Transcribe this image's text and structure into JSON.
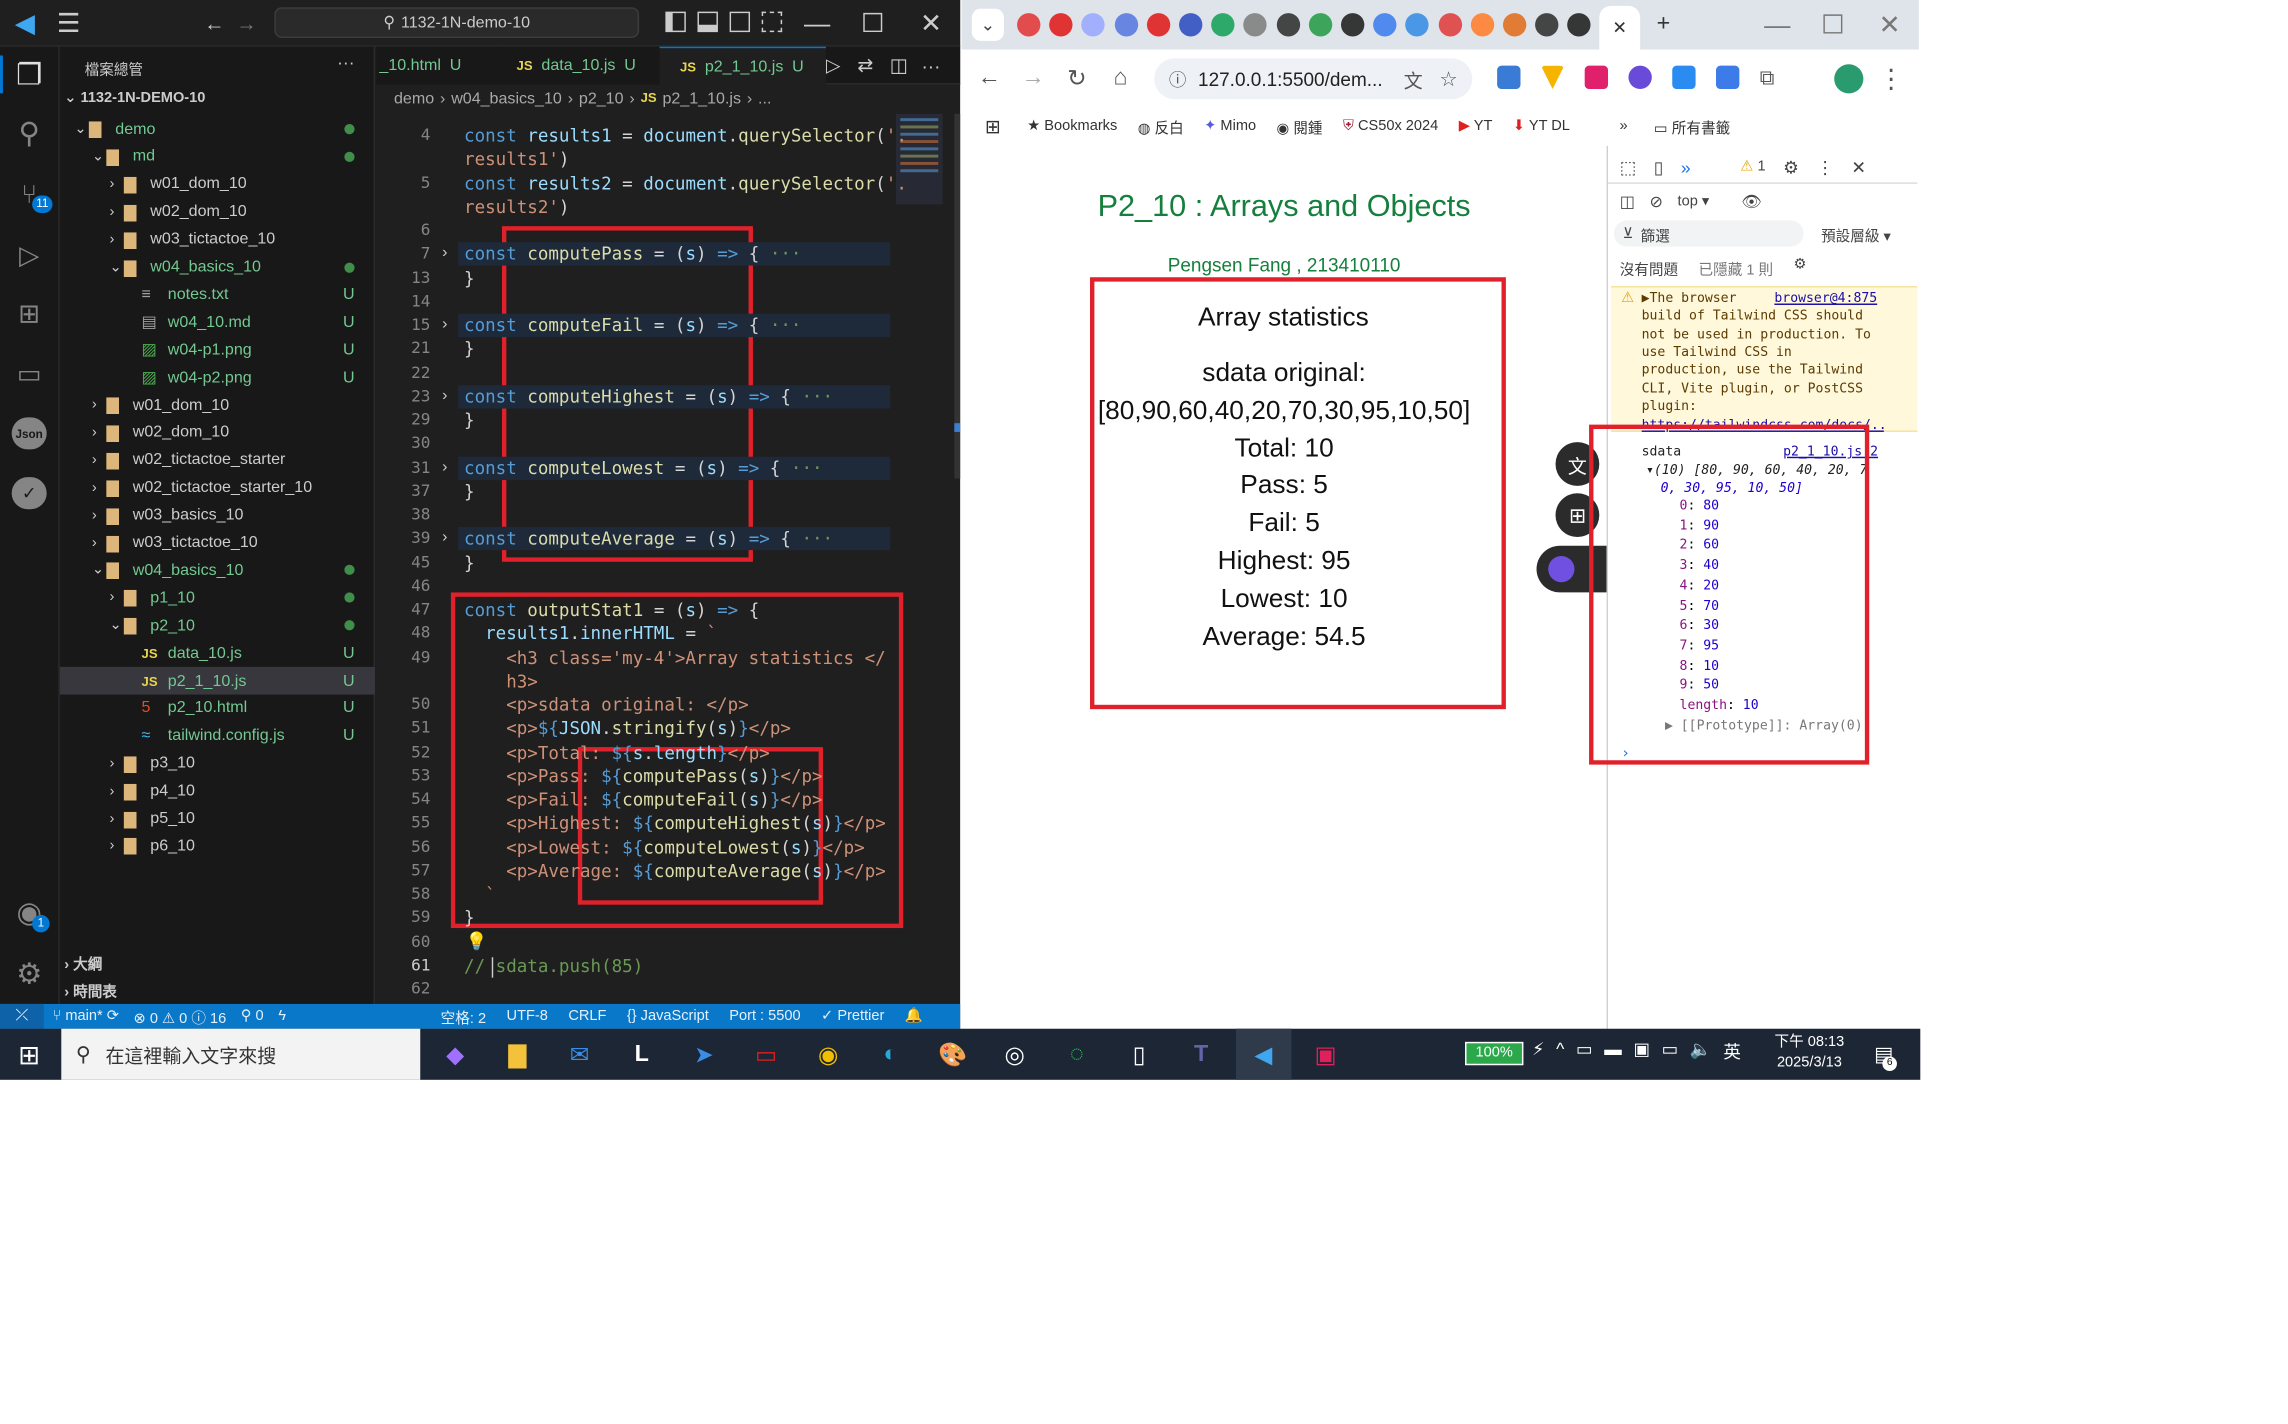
{
  "vscode": {
    "search": "1132-1N-demo-10",
    "explorer_title": "檔案總管",
    "explorer_more": "···",
    "root": "1132-1N-DEMO-10",
    "tree": [
      {
        "label": "demo",
        "indent": 0,
        "type": "folder",
        "open": true,
        "dot": true
      },
      {
        "label": "md",
        "indent": 1,
        "type": "folder",
        "open": true,
        "dot": true
      },
      {
        "label": "w01_dom_10",
        "indent": 2,
        "type": "folder",
        "open": false
      },
      {
        "label": "w02_dom_10",
        "indent": 2,
        "type": "folder",
        "open": false
      },
      {
        "label": "w03_tictactoe_10",
        "indent": 2,
        "type": "folder",
        "open": false
      },
      {
        "label": "w04_basics_10",
        "indent": 2,
        "type": "folder",
        "open": true,
        "dot": true
      },
      {
        "label": "notes.txt",
        "indent": 3,
        "type": "txt",
        "u": "U"
      },
      {
        "label": "w04_10.md",
        "indent": 3,
        "type": "md",
        "u": "U"
      },
      {
        "label": "w04-p1.png",
        "indent": 3,
        "type": "img",
        "u": "U"
      },
      {
        "label": "w04-p2.png",
        "indent": 3,
        "type": "img",
        "u": "U"
      },
      {
        "label": "w01_dom_10",
        "indent": 1,
        "type": "folder",
        "open": false
      },
      {
        "label": "w02_dom_10",
        "indent": 1,
        "type": "folder",
        "open": false
      },
      {
        "label": "w02_tictactoe_starter",
        "indent": 1,
        "type": "folder",
        "open": false
      },
      {
        "label": "w02_tictactoe_starter_10",
        "indent": 1,
        "type": "folder",
        "open": false
      },
      {
        "label": "w03_basics_10",
        "indent": 1,
        "type": "folder",
        "open": false
      },
      {
        "label": "w03_tictactoe_10",
        "indent": 1,
        "type": "folder",
        "open": false
      },
      {
        "label": "w04_basics_10",
        "indent": 1,
        "type": "folder",
        "open": true,
        "dot": true
      },
      {
        "label": "p1_10",
        "indent": 2,
        "type": "folder",
        "open": false,
        "dot": true
      },
      {
        "label": "p2_10",
        "indent": 2,
        "type": "folder",
        "open": true,
        "dot": true
      },
      {
        "label": "data_10.js",
        "indent": 3,
        "type": "js",
        "u": "U"
      },
      {
        "label": "p2_1_10.js",
        "indent": 3,
        "type": "js",
        "u": "U",
        "selected": true
      },
      {
        "label": "p2_10.html",
        "indent": 3,
        "type": "html",
        "u": "U"
      },
      {
        "label": "tailwind.config.js",
        "indent": 3,
        "type": "tw",
        "u": "U"
      },
      {
        "label": "p3_10",
        "indent": 2,
        "type": "folder",
        "open": false
      },
      {
        "label": "p4_10",
        "indent": 2,
        "type": "folder",
        "open": false
      },
      {
        "label": "p5_10",
        "indent": 2,
        "type": "folder",
        "open": false
      },
      {
        "label": "p6_10",
        "indent": 2,
        "type": "folder",
        "open": false
      }
    ],
    "outline": "大綱",
    "timeline": "時間表",
    "tabs": [
      {
        "name": "_10.html",
        "u": "U",
        "js": false
      },
      {
        "name": "data_10.js",
        "u": "U",
        "js": true
      },
      {
        "name": "p2_1_10.js",
        "u": "U",
        "js": true,
        "active": true
      }
    ],
    "breadcrumb": [
      "demo",
      "w04_basics_10",
      "p2_10",
      "p2_1_10.js",
      "..."
    ],
    "lines": [
      {
        "n": "4",
        "c": [
          [
            "kw",
            "const "
          ],
          [
            "vr",
            "results1"
          ],
          [
            "op",
            " = "
          ],
          [
            "vr",
            "document"
          ],
          [
            "op",
            "."
          ],
          [
            "fn",
            "querySelector"
          ],
          [
            "op",
            "("
          ],
          [
            "st",
            "'."
          ]
        ]
      },
      {
        "n": "",
        "c": [
          [
            "st",
            "results1'"
          ],
          [
            "op",
            ")"
          ]
        ]
      },
      {
        "n": "5",
        "c": [
          [
            "kw",
            "const "
          ],
          [
            "vr",
            "results2"
          ],
          [
            "op",
            " = "
          ],
          [
            "vr",
            "document"
          ],
          [
            "op",
            "."
          ],
          [
            "fn",
            "querySelector"
          ],
          [
            "op",
            "("
          ],
          [
            "st",
            "'."
          ]
        ]
      },
      {
        "n": "",
        "c": [
          [
            "st",
            "results2'"
          ],
          [
            "op",
            ")"
          ]
        ]
      },
      {
        "n": "6",
        "c": []
      },
      {
        "n": "7",
        "fold": true,
        "c": [
          [
            "kw",
            "const "
          ],
          [
            "fn",
            "computePass"
          ],
          [
            "op",
            " = ("
          ],
          [
            "vr",
            "s"
          ],
          [
            "op",
            ") "
          ],
          [
            "kw",
            "=>"
          ],
          [
            "op",
            " { "
          ],
          [
            "cm",
            "···"
          ]
        ]
      },
      {
        "n": "13",
        "c": [
          [
            "op",
            "}"
          ]
        ]
      },
      {
        "n": "14",
        "c": []
      },
      {
        "n": "15",
        "fold": true,
        "c": [
          [
            "kw",
            "const "
          ],
          [
            "fn",
            "computeFail"
          ],
          [
            "op",
            " = ("
          ],
          [
            "vr",
            "s"
          ],
          [
            "op",
            ") "
          ],
          [
            "kw",
            "=>"
          ],
          [
            "op",
            " { "
          ],
          [
            "cm",
            "···"
          ]
        ]
      },
      {
        "n": "21",
        "c": [
          [
            "op",
            "}"
          ]
        ]
      },
      {
        "n": "22",
        "c": []
      },
      {
        "n": "23",
        "fold": true,
        "c": [
          [
            "kw",
            "const "
          ],
          [
            "fn",
            "computeHighest"
          ],
          [
            "op",
            " = ("
          ],
          [
            "vr",
            "s"
          ],
          [
            "op",
            ") "
          ],
          [
            "kw",
            "=>"
          ],
          [
            "op",
            " { "
          ],
          [
            "cm",
            "···"
          ]
        ]
      },
      {
        "n": "29",
        "c": [
          [
            "op",
            "}"
          ]
        ]
      },
      {
        "n": "30",
        "c": []
      },
      {
        "n": "31",
        "fold": true,
        "c": [
          [
            "kw",
            "const "
          ],
          [
            "fn",
            "computeLowest"
          ],
          [
            "op",
            " = ("
          ],
          [
            "vr",
            "s"
          ],
          [
            "op",
            ") "
          ],
          [
            "kw",
            "=>"
          ],
          [
            "op",
            " { "
          ],
          [
            "cm",
            "···"
          ]
        ]
      },
      {
        "n": "37",
        "c": [
          [
            "op",
            "}"
          ]
        ]
      },
      {
        "n": "38",
        "c": []
      },
      {
        "n": "39",
        "fold": true,
        "c": [
          [
            "kw",
            "const "
          ],
          [
            "fn",
            "computeAverage"
          ],
          [
            "op",
            " = ("
          ],
          [
            "vr",
            "s"
          ],
          [
            "op",
            ") "
          ],
          [
            "kw",
            "=>"
          ],
          [
            "op",
            " { "
          ],
          [
            "cm",
            "···"
          ]
        ]
      },
      {
        "n": "45",
        "c": [
          [
            "op",
            "}"
          ]
        ]
      },
      {
        "n": "46",
        "c": []
      },
      {
        "n": "47",
        "c": [
          [
            "kw",
            "const "
          ],
          [
            "fn",
            "outputStat1"
          ],
          [
            "op",
            " = ("
          ],
          [
            "vr",
            "s"
          ],
          [
            "op",
            ") "
          ],
          [
            "kw",
            "=>"
          ],
          [
            "op",
            " {"
          ]
        ]
      },
      {
        "n": "48",
        "c": [
          [
            "op",
            "  "
          ],
          [
            "vr",
            "results1"
          ],
          [
            "op",
            "."
          ],
          [
            "vr",
            "innerHTML"
          ],
          [
            "op",
            " = "
          ],
          [
            "st",
            "`"
          ]
        ]
      },
      {
        "n": "49",
        "c": [
          [
            "st",
            "    <h3 class='my-4'>Array statistics </"
          ]
        ]
      },
      {
        "n": "",
        "c": [
          [
            "st",
            "    h3>"
          ]
        ]
      },
      {
        "n": "50",
        "c": [
          [
            "st",
            "    <p>sdata original: </p>"
          ]
        ]
      },
      {
        "n": "51",
        "c": [
          [
            "st",
            "    <p>"
          ],
          [
            "kw",
            "${"
          ],
          [
            "vr",
            "JSON"
          ],
          [
            "op",
            "."
          ],
          [
            "fn",
            "stringify"
          ],
          [
            "op",
            "("
          ],
          [
            "vr",
            "s"
          ],
          [
            "op",
            ")"
          ],
          [
            "kw",
            "}"
          ],
          [
            "st",
            "</p>"
          ]
        ]
      },
      {
        "n": "52",
        "c": [
          [
            "st",
            "    <p>Total: "
          ],
          [
            "kw",
            "${"
          ],
          [
            "vr",
            "s"
          ],
          [
            "op",
            "."
          ],
          [
            "vr",
            "length"
          ],
          [
            "kw",
            "}"
          ],
          [
            "st",
            "</p>"
          ]
        ]
      },
      {
        "n": "53",
        "c": [
          [
            "st",
            "    <p>Pass: "
          ],
          [
            "kw",
            "${"
          ],
          [
            "fn",
            "computePass"
          ],
          [
            "op",
            "("
          ],
          [
            "vr",
            "s"
          ],
          [
            "op",
            ")"
          ],
          [
            "kw",
            "}"
          ],
          [
            "st",
            "</p>"
          ]
        ]
      },
      {
        "n": "54",
        "c": [
          [
            "st",
            "    <p>Fail: "
          ],
          [
            "kw",
            "${"
          ],
          [
            "fn",
            "computeFail"
          ],
          [
            "op",
            "("
          ],
          [
            "vr",
            "s"
          ],
          [
            "op",
            ")"
          ],
          [
            "kw",
            "}"
          ],
          [
            "st",
            "</p>"
          ]
        ]
      },
      {
        "n": "55",
        "c": [
          [
            "st",
            "    <p>Highest: "
          ],
          [
            "kw",
            "${"
          ],
          [
            "fn",
            "computeHighest"
          ],
          [
            "op",
            "("
          ],
          [
            "vr",
            "s"
          ],
          [
            "op",
            ")"
          ],
          [
            "kw",
            "}"
          ],
          [
            "st",
            "</p>"
          ]
        ]
      },
      {
        "n": "56",
        "c": [
          [
            "st",
            "    <p>Lowest: "
          ],
          [
            "kw",
            "${"
          ],
          [
            "fn",
            "computeLowest"
          ],
          [
            "op",
            "("
          ],
          [
            "vr",
            "s"
          ],
          [
            "op",
            ")"
          ],
          [
            "kw",
            "}"
          ],
          [
            "st",
            "</p>"
          ]
        ]
      },
      {
        "n": "57",
        "c": [
          [
            "st",
            "    <p>Average: "
          ],
          [
            "kw",
            "${"
          ],
          [
            "fn",
            "computeAverage"
          ],
          [
            "op",
            "("
          ],
          [
            "vr",
            "s"
          ],
          [
            "op",
            ")"
          ],
          [
            "kw",
            "}"
          ],
          [
            "st",
            "</p>"
          ]
        ]
      },
      {
        "n": "58",
        "c": [
          [
            "st",
            "  `"
          ]
        ]
      },
      {
        "n": "59",
        "c": [
          [
            "op",
            "}"
          ]
        ]
      },
      {
        "n": "60",
        "c": []
      },
      {
        "n": "61",
        "c": [
          [
            "cm",
            "// sdata.push(85)"
          ]
        ]
      },
      {
        "n": "62",
        "c": []
      }
    ],
    "status": {
      "branch": "main*",
      "problems": "⊗ 0 ⚠ 0 ⓘ 16",
      "ports": "⚲ 0",
      "spaces": "空格: 2",
      "encoding": "UTF-8",
      "eol": "CRLF",
      "lang": "{} JavaScript",
      "port": "Port : 5500",
      "prettier": "✓ Prettier"
    },
    "badges": {
      "scm": "11",
      "account": "1"
    }
  },
  "browser": {
    "url": "127.0.0.1:5500/dem...",
    "bookmarks": [
      "Bookmarks",
      "反白",
      "Mimo",
      "閱鍾",
      "CS50x 2024",
      "YT",
      "YT DL"
    ],
    "all_bookmarks": "所有書籤",
    "page": {
      "title": "P2_10 : Arrays and Objects",
      "author": "Pengsen Fang , 213410110",
      "heading": "Array statistics",
      "lines": [
        "sdata original:",
        "[80,90,60,40,20,70,30,95,10,50]",
        "Total: 10",
        "Pass: 5",
        "Fail: 5",
        "Highest: 95",
        "Lowest: 10",
        "Average: 54.5"
      ]
    },
    "devtools": {
      "warn_count": "1",
      "context": "top",
      "filter": "篩選",
      "levels": "預設層級",
      "no_issues": "沒有問題",
      "hidden": "已隱藏 1 則",
      "warning_lines": [
        "▶The browser",
        "build of Tailwind CSS should",
        "not be used in production. To",
        "use Tailwind CSS in",
        "production, use the Tailwind",
        "CLI, Vite plugin, or PostCSS",
        "plugin:"
      ],
      "warning_link": "browser@4:875",
      "warning_url": "https://tailwindcss.com/docs/...",
      "log_label": "sdata",
      "log_src": "p2_1_10.js:2",
      "log_summary1": "(10) [80, 90, 60, 40, 20, 7",
      "log_summary2": "0, 30, 95, 10, 50]",
      "items": [
        {
          "k": "0",
          "v": "80"
        },
        {
          "k": "1",
          "v": "90"
        },
        {
          "k": "2",
          "v": "60"
        },
        {
          "k": "3",
          "v": "40"
        },
        {
          "k": "4",
          "v": "20"
        },
        {
          "k": "5",
          "v": "70"
        },
        {
          "k": "6",
          "v": "30"
        },
        {
          "k": "7",
          "v": "95"
        },
        {
          "k": "8",
          "v": "10"
        },
        {
          "k": "9",
          "v": "50"
        }
      ],
      "length_label": "length",
      "length_val": "10",
      "proto": "▶ [[Prototype]]: Array(0)"
    }
  },
  "taskbar": {
    "search_placeholder": "在這裡輸入文字來搜",
    "battery": "100%",
    "ime": "英",
    "time": "下午 08:13",
    "date": "2025/3/13",
    "notif": "6"
  }
}
